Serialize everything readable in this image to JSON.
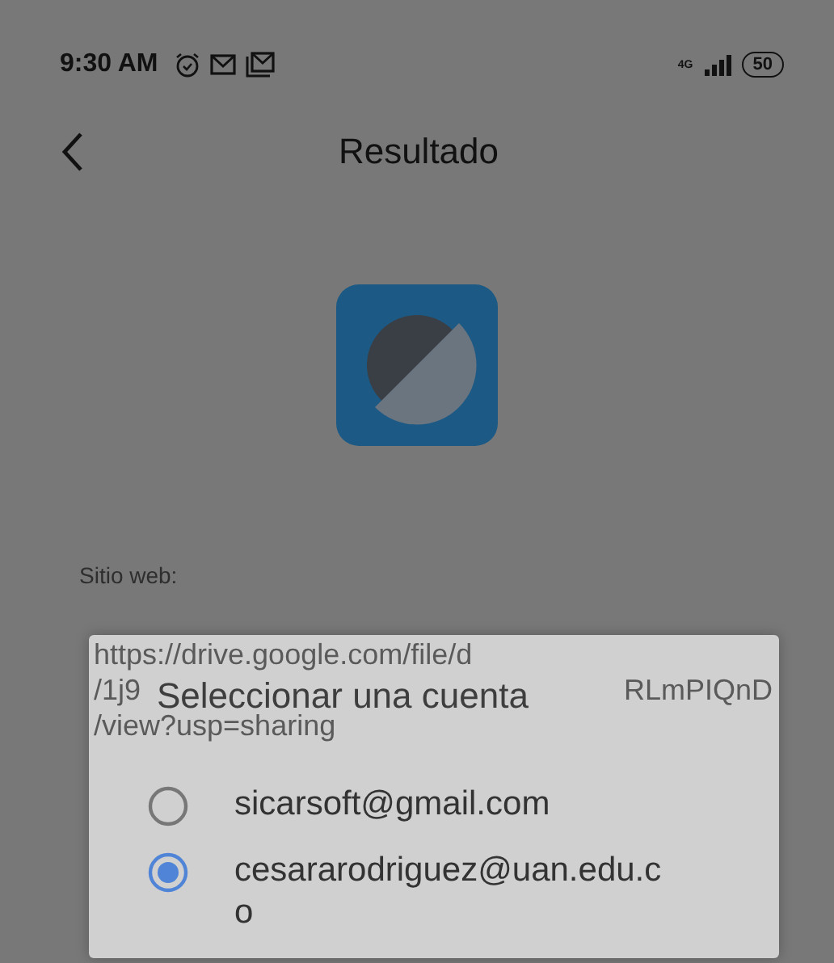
{
  "status_bar": {
    "time": "9:30 AM",
    "network": "4G",
    "battery": "50"
  },
  "header": {
    "title": "Resultado"
  },
  "website": {
    "label": "Sitio web:",
    "url_lines": [
      {
        "left": "https://drive.google.com/file/d"
      },
      {
        "left": "/1j9",
        "right": "RLmPIQnD"
      },
      {
        "left": "/view?usp=sharing"
      }
    ]
  },
  "dialog": {
    "title": "Seleccionar una cuenta",
    "accounts": [
      {
        "email": "sicarsoft@gmail.com",
        "selected": false
      },
      {
        "email": "cesararodriguez@uan.edu.co",
        "selected": true
      }
    ]
  }
}
